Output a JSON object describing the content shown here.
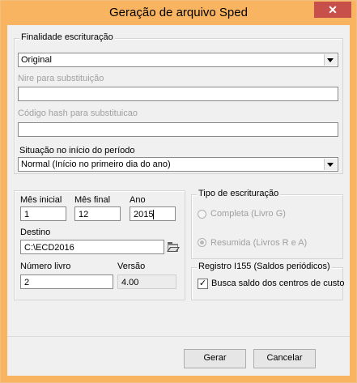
{
  "window": {
    "title": "Geração de arquivo Sped",
    "close_symbol": "✕"
  },
  "finalidade": {
    "legend": "Finalidade escrituração",
    "selected": "Original",
    "nire_label": "Nire para substituição",
    "nire_value": "",
    "hash_label": "Código hash para substituicao",
    "hash_value": "",
    "situacao_label": "Situação no início do período",
    "situacao_selected": "Normal (Início no primeiro dia do ano)"
  },
  "periodo": {
    "mes_inicial_label": "Mês inicial",
    "mes_inicial_value": "1",
    "mes_final_label": "Mês final",
    "mes_final_value": "12",
    "ano_label": "Ano",
    "ano_value": "2015",
    "destino_label": "Destino",
    "destino_value": "C:\\ECD2016",
    "numero_livro_label": "Número livro",
    "numero_livro_value": "2",
    "versao_label": "Versão",
    "versao_value": "4.00"
  },
  "tipo": {
    "legend": "Tipo de escrituração",
    "option_completa": "Completa (Livro G)",
    "option_resumida": "Resumida (Livros R e A)"
  },
  "registro": {
    "legend": "Registro I155 (Saldos periódicos)",
    "checkbox_label": "Busca saldo dos centros de custo",
    "checked": true
  },
  "buttons": {
    "gerar": "Gerar",
    "cancelar": "Cancelar"
  }
}
